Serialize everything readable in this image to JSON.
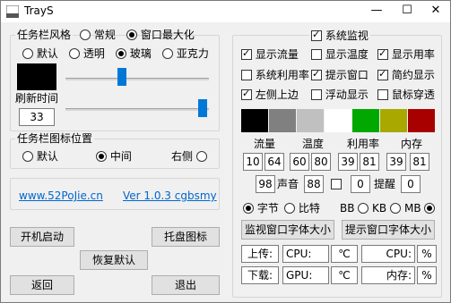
{
  "window": {
    "title": "TrayS",
    "minimize": "—",
    "maximize": "☐",
    "close": "✕"
  },
  "left": {
    "style_group": "任务栏风格",
    "style_normal": "常规",
    "style_maximized": "窗口最大化",
    "opt_default": "默认",
    "opt_transparent": "透明",
    "opt_glass": "玻璃",
    "opt_acrylic": "亚克力",
    "refresh_label": "刷新时间",
    "refresh_value": "33",
    "position_group": "任务栏图标位置",
    "pos_default": "默认",
    "pos_center": "中间",
    "pos_right": "右侧",
    "site_link": "www.52PoJie.cn",
    "version_link": "Ver 1.0.3 cgbsmy",
    "btn_autostart": "开机启动",
    "btn_tray": "托盘图标",
    "btn_restore": "恢复默认",
    "btn_back": "返回",
    "btn_exit": "退出"
  },
  "right": {
    "monitor_group": "系统监视",
    "show_traffic": "显示流量",
    "show_temp": "显示温度",
    "show_usage": "显示用率",
    "sys_usage": "系统利用率",
    "tip_window": "提示窗口",
    "compact_display": "简约显示",
    "left_top": "左侧上边",
    "float_display": "浮动显示",
    "mouse_through": "鼠标穿透",
    "colors": [
      "#000000",
      "#808080",
      "#c0c0c0",
      "#ffffff",
      "#00a800",
      "#a8a800",
      "#a80000"
    ],
    "hdr_traffic": "流量",
    "hdr_temp": "温度",
    "hdr_usage": "利用率",
    "hdr_memory": "内存",
    "vals": [
      "10",
      "64",
      "60",
      "80",
      "39",
      "81",
      "39",
      "81"
    ],
    "sound_val": "98",
    "sound_label": "声音",
    "sound_val2": "88",
    "remind_left": "0",
    "remind_label": "提醒",
    "remind_right": "0",
    "unit_byte": "字节",
    "unit_bit": "比特",
    "unit_bb": "BB",
    "unit_kb": "KB",
    "unit_mb": "MB",
    "btn_monitor_font": "监视窗口字体大小",
    "btn_tip_font": "提示窗口字体大小",
    "upload_label": "上传:",
    "cpu_label": "CPU:",
    "celsius": "℃",
    "cpu_label2": "CPU:",
    "percent": "%",
    "download_label": "下载:",
    "gpu_label": "GPU:",
    "celsius2": "℃",
    "memory_label": "内存:",
    "percent2": "%"
  }
}
